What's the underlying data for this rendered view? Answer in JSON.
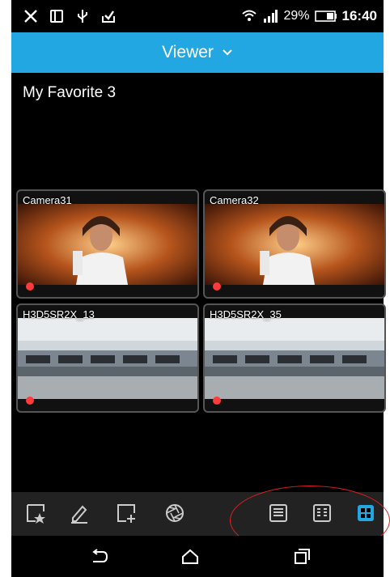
{
  "status_bar": {
    "icons": [
      "usb-debug-icon",
      "tablet-icon",
      "usb-icon",
      "download-icon",
      "wifi-icon",
      "signal-icon",
      "battery-icon"
    ],
    "battery_percent": "29%",
    "time": "16:40"
  },
  "header": {
    "title": "Viewer",
    "chevron_icon": "chevron-down-icon",
    "color": "#22a7e3"
  },
  "page": {
    "title": "My Favorite 3"
  },
  "cameras": [
    {
      "name": "Camera31",
      "recording": true
    },
    {
      "name": "Camera32",
      "recording": true
    },
    {
      "name": "H3D5SR2X_13",
      "recording": true
    },
    {
      "name": "H3D5SR2X_35",
      "recording": true
    }
  ],
  "toolbar": {
    "buttons": [
      {
        "icon": "favorite-star-icon"
      },
      {
        "icon": "edit-pencil-icon"
      },
      {
        "icon": "add-view-icon"
      },
      {
        "icon": "aperture-icon"
      },
      {
        "icon": "layout-list-icon"
      },
      {
        "icon": "layout-grid-3-icon"
      },
      {
        "icon": "layout-grid-4-icon",
        "active": true
      }
    ],
    "active_color": "#22a7e3",
    "annotation_color": "#e02020"
  },
  "navbar": {
    "buttons": [
      {
        "icon": "back-icon"
      },
      {
        "icon": "home-icon"
      },
      {
        "icon": "recents-icon"
      }
    ]
  }
}
